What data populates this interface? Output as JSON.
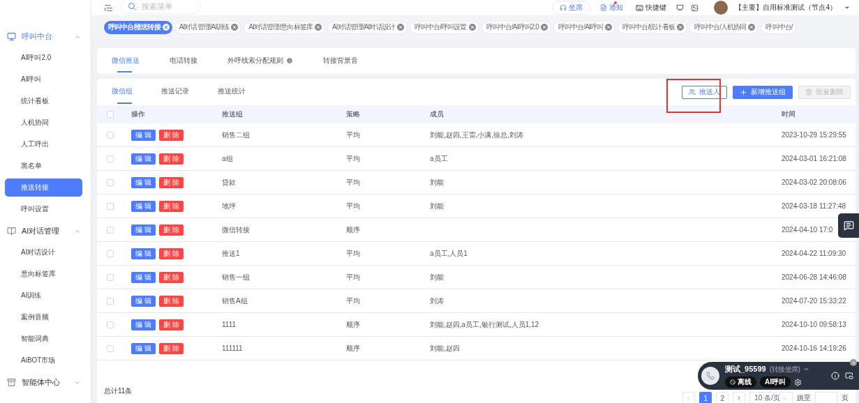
{
  "topbar": {
    "search": {
      "placeholder": "搜索菜单"
    },
    "seat_button": "坐席",
    "notice": {
      "label": "通知",
      "unread": true
    },
    "shortcut": "快捷键",
    "account": "【主要】自用标准测试（节点4）"
  },
  "open_tabs": [
    {
      "label": "呼叫中台/推送转接",
      "selected": true,
      "closable": true
    },
    {
      "label": "AI对话管理/AI训练",
      "selected": false,
      "closable": true
    },
    {
      "label": "AI对话管理/意向标签库",
      "selected": false,
      "closable": true
    },
    {
      "label": "AI对话管理/AI对话设计",
      "selected": false,
      "closable": true
    },
    {
      "label": "呼叫中台/呼叫设置",
      "selected": false,
      "closable": true
    },
    {
      "label": "呼叫中台/AI呼叫2.0",
      "selected": false,
      "closable": true
    },
    {
      "label": "呼叫中台/AI呼叫",
      "selected": false,
      "closable": true
    },
    {
      "label": "呼叫中台/统计看板",
      "selected": false,
      "closable": true
    },
    {
      "label": "呼叫中台/人机协同",
      "selected": false,
      "closable": true
    },
    {
      "label": "呼叫中台/",
      "selected": false,
      "closable": false
    }
  ],
  "sidebar": {
    "groups": [
      {
        "label": "呼叫中台",
        "kind": "monitor",
        "selected": true,
        "expanded": true,
        "children": [
          {
            "label": "AI呼叫2.0",
            "selected": false
          },
          {
            "label": "AI呼叫",
            "selected": false
          },
          {
            "label": "统计看板",
            "selected": false
          },
          {
            "label": "人机协同",
            "selected": false
          },
          {
            "label": "人工呼出",
            "selected": false
          },
          {
            "label": "黑名单",
            "selected": false
          },
          {
            "label": "推送转接",
            "selected": true
          },
          {
            "label": "呼叫设置",
            "selected": false
          }
        ]
      },
      {
        "label": "AI对话管理",
        "kind": "book",
        "selected": false,
        "expanded": true,
        "children": [
          {
            "label": "AI对话设计",
            "selected": false
          },
          {
            "label": "意向标签库",
            "selected": false
          },
          {
            "label": "AI训练",
            "selected": false
          },
          {
            "label": "案例音频",
            "selected": false
          },
          {
            "label": "智能词典",
            "selected": false
          },
          {
            "label": "AiBOT市场",
            "selected": false
          }
        ]
      },
      {
        "label": "智能体中心",
        "kind": "archive",
        "selected": false,
        "expanded": false
      }
    ]
  },
  "page_tabs": [
    {
      "label": "微信推送",
      "selected": true
    },
    {
      "label": "电话转接",
      "selected": false
    },
    {
      "label": "外呼线索分配规则",
      "selected": false,
      "info": true
    },
    {
      "label": "转接背景音",
      "selected": false
    }
  ],
  "sub_tabs": [
    {
      "label": "微信组",
      "selected": true
    },
    {
      "label": "推送记录",
      "selected": false
    },
    {
      "label": "推送统计",
      "selected": false
    }
  ],
  "actions": [
    {
      "label": "推送人",
      "kind": "outline",
      "disabled": false,
      "highlighted": true
    },
    {
      "label": "新增推送组",
      "kind": "primary",
      "disabled": false,
      "highlighted": false
    },
    {
      "label": "批量删除",
      "kind": "delete",
      "disabled": true,
      "highlighted": false
    }
  ],
  "table": {
    "select_all": false,
    "columns": [
      "操作",
      "推送组",
      "策略",
      "成员",
      "时间"
    ],
    "rows": [
      {
        "checked": false,
        "edit": "编 辑",
        "delete": "删 除",
        "group": "销售二组",
        "strategy": "平均",
        "members": "刘能,赵四,王雷,小满,徐总,刘涛",
        "time": "2023-10-29 15:29:55"
      },
      {
        "checked": false,
        "edit": "编 辑",
        "delete": "删 除",
        "group": "a组",
        "strategy": "平均",
        "members": "a员工",
        "time": "2024-03-01 16:21:08"
      },
      {
        "checked": false,
        "edit": "编 辑",
        "delete": "删 除",
        "group": "贷款",
        "strategy": "平均",
        "members": "刘能",
        "time": "2024-03-02 20:08:06"
      },
      {
        "checked": false,
        "edit": "编 辑",
        "delete": "删 除",
        "group": "地坪",
        "strategy": "平均",
        "members": "刘能",
        "time": "2024-03-18 11:27:48"
      },
      {
        "checked": false,
        "edit": "编 辑",
        "delete": "删 除",
        "group": "微信转接",
        "strategy": "顺序",
        "time": "2024-04-10 17:0"
      },
      {
        "checked": false,
        "edit": "编 辑",
        "delete": "删 除",
        "group": "推送1",
        "strategy": "平均",
        "members": "a员工,人员1",
        "time": "2024-04-22 11:09:30"
      },
      {
        "checked": false,
        "edit": "编 辑",
        "delete": "删 除",
        "group": "销售一组",
        "strategy": "平均",
        "members": "刘能",
        "time": "2024-06-28 14:46:08"
      },
      {
        "checked": false,
        "edit": "编 辑",
        "delete": "删 除",
        "group": "销售A组",
        "strategy": "平均",
        "members": "刘涛",
        "time": "2024-07-20 15:33:22"
      },
      {
        "checked": false,
        "edit": "编 辑",
        "delete": "删 除",
        "group": "1111",
        "strategy": "顺序",
        "members": "刘能,赵四,a员工,银行测试,人员1,12",
        "time": "2024-10-10 09:58:13"
      },
      {
        "checked": false,
        "edit": "编 辑",
        "delete": "删 除",
        "group": "111111",
        "strategy": "顺序",
        "members": "刘能,赵四",
        "time": "2024-10-16 14:19:26"
      }
    ]
  },
  "footer": {
    "total": "总计11条",
    "pages": [
      {
        "label": "1",
        "selected": true
      },
      {
        "label": "2",
        "selected": false
      }
    ],
    "page_size": "10 条/页",
    "jump_label": "跳至",
    "page_unit": "页"
  },
  "phone_widget": {
    "name": "测试_95599",
    "mode": "(转接坐席)",
    "status": "离线",
    "ai_call": "AI呼叫"
  }
}
